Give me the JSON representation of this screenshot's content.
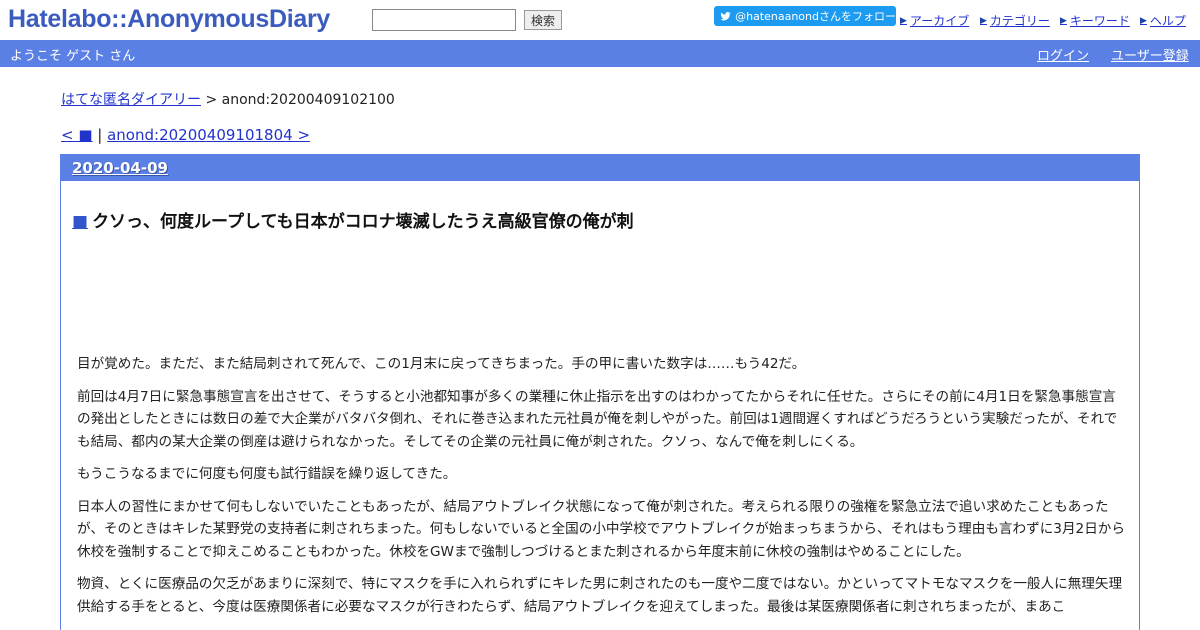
{
  "header": {
    "logo": "Hatelabo::AnonymousDiary",
    "search_placeholder": "",
    "search_button": "検索",
    "follow_label": "@hatenaanondさんをフォロー",
    "nav": [
      "アーカイブ",
      "カテゴリー",
      "キーワード",
      "ヘルプ"
    ]
  },
  "welcome_bar": {
    "welcome": "ようこそ ゲスト さん",
    "login": "ログイン",
    "register": "ユーザー登録"
  },
  "breadcrumb": {
    "home": "はてな匿名ダイアリー",
    "separator": " > ",
    "current": "anond:20200409102100"
  },
  "pager": {
    "prev": "< ■",
    "separator": " | ",
    "next": "anond:20200409101804 >"
  },
  "entry": {
    "date": "2020-04-09",
    "title_mark": "■",
    "title": "クソっ、何度ループしても日本がコロナ壊滅したうえ高級官僚の俺が刺",
    "paragraphs": [
      "目が覚めた。まただ、また結局刺されて死んで、この1月末に戻ってきちまった。手の甲に書いた数字は……もう42だ。",
      "前回は4月7日に緊急事態宣言を出させて、そうすると小池都知事が多くの業種に休止指示を出すのはわかってたからそれに任せた。さらにその前に4月1日を緊急事態宣言の発出としたときには数日の差で大企業がバタバタ倒れ、それに巻き込まれた元社員が俺を刺しやがった。前回は1週間遅くすればどうだろうという実験だったが、それでも結局、都内の某大企業の倒産は避けられなかった。そしてその企業の元社員に俺が刺された。クソっ、なんで俺を刺しにくる。",
      "もうこうなるまでに何度も何度も試行錯誤を繰り返してきた。",
      "日本人の習性にまかせて何もしないでいたこともあったが、結局アウトブレイク状態になって俺が刺された。考えられる限りの強権を緊急立法で追い求めたこともあったが、そのときはキレた某野党の支持者に刺されちまった。何もしないでいると全国の小中学校でアウトブレイクが始まっちまうから、それはもう理由も言わずに3月2日から休校を強制することで抑えこめることもわかった。休校をGWまで強制しつづけるとまた刺されるから年度末前に休校の強制はやめることにした。",
      "物資、とくに医療品の欠乏があまりに深刻で、特にマスクを手に入れられずにキレた男に刺されたのも一度や二度ではない。かといってマトモなマスクを一般人に無理矢理供給する手をとると、今度は医療関係者に必要なマスクが行きわたらず、結局アウトブレイクを迎えてしまった。最後は某医療関係者に刺されちまったが、まあこ"
    ]
  }
}
